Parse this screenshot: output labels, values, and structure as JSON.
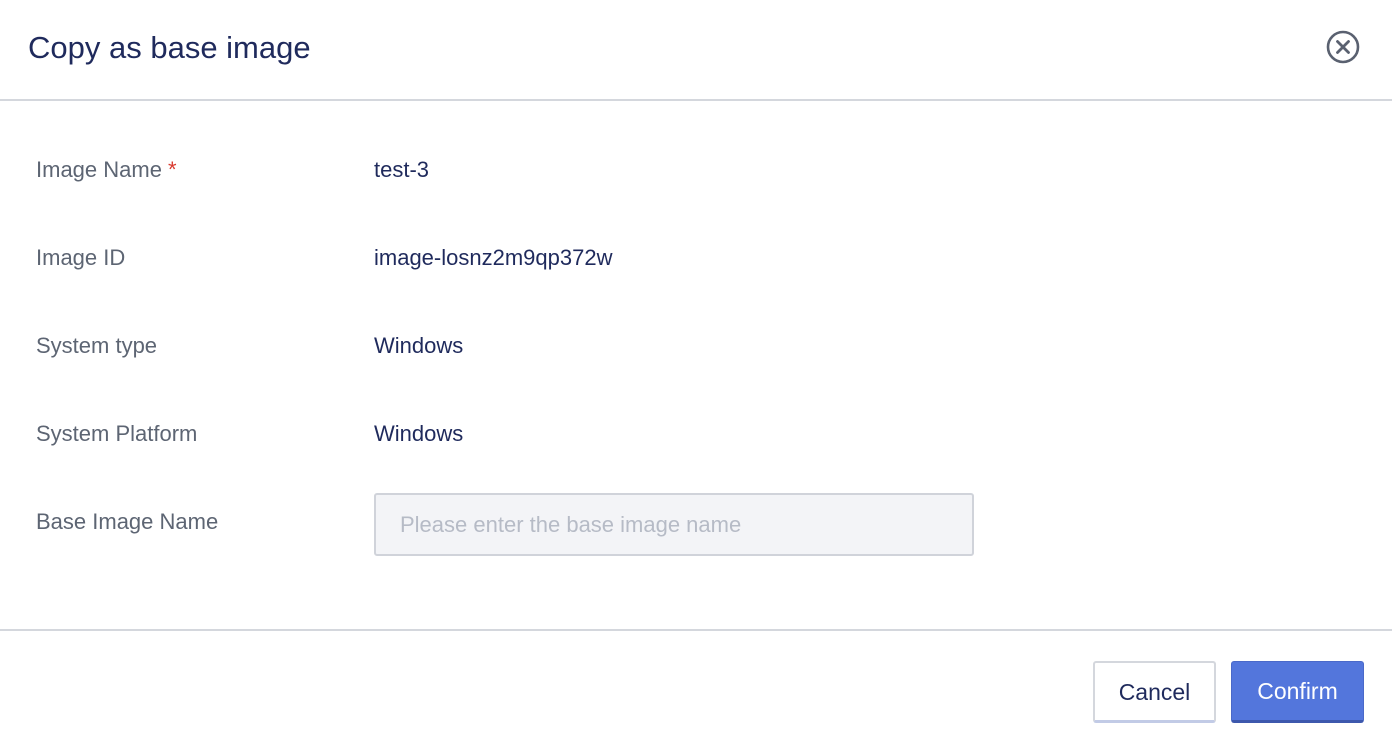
{
  "dialog": {
    "title": "Copy as base image",
    "close_icon": "close-circle-icon"
  },
  "form": {
    "image_name": {
      "label": "Image Name",
      "required_mark": "*",
      "value": "test-3"
    },
    "image_id": {
      "label": "Image ID",
      "value": "image-losnz2m9qp372w"
    },
    "system_type": {
      "label": "System type",
      "value": "Windows"
    },
    "system_platform": {
      "label": "System Platform",
      "value": "Windows"
    },
    "base_image_name": {
      "label": "Base Image Name",
      "value": "",
      "placeholder": "Please enter the base image name"
    }
  },
  "footer": {
    "cancel_label": "Cancel",
    "confirm_label": "Confirm"
  },
  "colors": {
    "primary": "#5376dc",
    "title_text": "#1f2a5c",
    "label_text": "#5d6573",
    "required": "#d93a2f"
  }
}
